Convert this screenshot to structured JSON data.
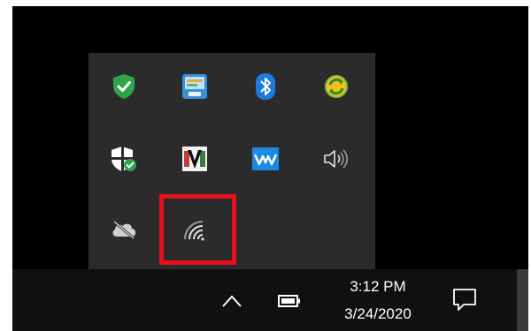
{
  "tray": {
    "icons": [
      {
        "name": "windows-security-icon"
      },
      {
        "name": "network-tool-icon"
      },
      {
        "name": "bluetooth-icon"
      },
      {
        "name": "sync-icon"
      },
      {
        "name": "windows-defender-icon"
      },
      {
        "name": "app-v-icon"
      },
      {
        "name": "waves-audio-icon"
      },
      {
        "name": "speaker-volume-icon"
      },
      {
        "name": "onedrive-icon"
      },
      {
        "name": "wifi-icon"
      }
    ],
    "highlight_color": "#e8101a"
  },
  "taskbar": {
    "time": "3:12 PM",
    "date": "3/24/2020",
    "icons": [
      "chevron-up-icon",
      "battery-icon",
      "action-center-icon"
    ]
  },
  "colors": {
    "flyout_bg": "#2b2b2b",
    "taskbar_bg": "#101010",
    "shield_green": "#2fa34a",
    "bluetooth_blue": "#1f7ae0"
  }
}
